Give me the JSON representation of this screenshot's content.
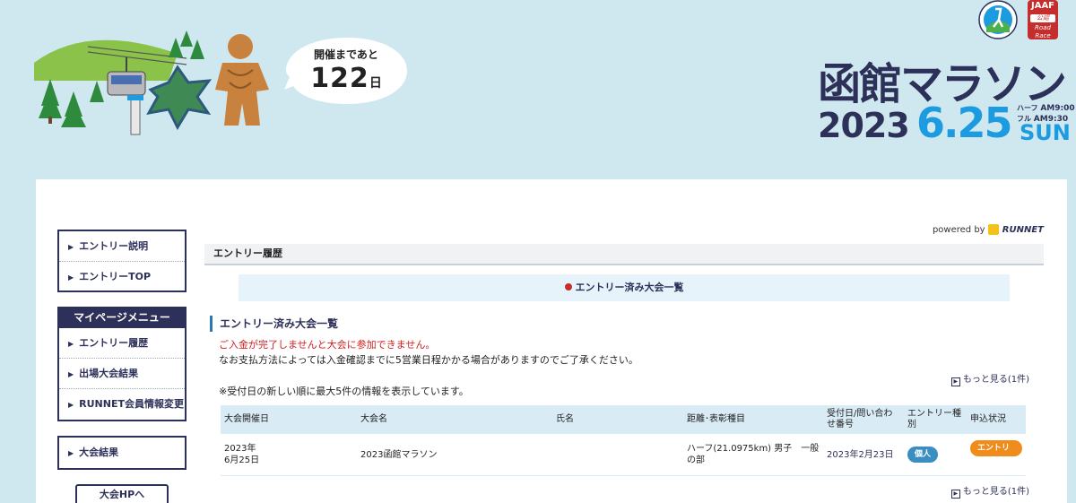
{
  "header": {
    "countdown_label": "開催まであと",
    "countdown_days": "122",
    "countdown_unit": "日",
    "badge_jaaf": "JAAF",
    "badge_jaaf_sub": "公認",
    "badge_road": "Road Race",
    "logo_title": "函館マラソン",
    "logo_year": "2023",
    "logo_date": "6.25",
    "logo_dow": "SUN",
    "half_label": "ハーフ",
    "half_time": "AM9:00",
    "full_label": "フル",
    "full_time": "AM9:30"
  },
  "sidebar": {
    "top_items": [
      "エントリー説明",
      "エントリーTOP"
    ],
    "menu_title": "マイページメニュー",
    "menu_items": [
      "エントリー履歴",
      "出場大会結果",
      "RUNNET会員情報変更"
    ],
    "results_item": "大会結果",
    "hp_button": "大会HPへ"
  },
  "main": {
    "powered_by": "powered by",
    "brand": "RUNNET",
    "page_title": "エントリー履歴",
    "tab_label": "エントリー済み大会一覧",
    "section_title": "エントリー済み大会一覧",
    "warning": "ご入金が完了しませんと大会に参加できません。",
    "notice": "なお支払方法によっては入金確認までに5営業日程かかる場合がありますのでご了承ください。",
    "more_link": "もっと見る(1件)",
    "info": "※受付日の新しい順に最大5件の情報を表示しています。",
    "table_headers": [
      "大会開催日",
      "大会名",
      "氏名",
      "距離･表彰種目",
      "受付日/問い合わせ番号",
      "エントリー種別",
      "申込状況"
    ],
    "rows": [
      {
        "date_year": "2023年",
        "date_day": "6月25日",
        "name": "2023函館マラソン",
        "person": "",
        "category": "ハーフ(21.0975km) 男子　一般の部",
        "received": "2023年2月23日",
        "entry_type": "個人",
        "status": "エントリー完了"
      }
    ]
  },
  "colors": {
    "background": "#cfe8ef",
    "navy": "#2d3159",
    "accent_blue": "#1c9be0",
    "warning_red": "#d41c1c",
    "status_orange": "#f08c1b"
  }
}
